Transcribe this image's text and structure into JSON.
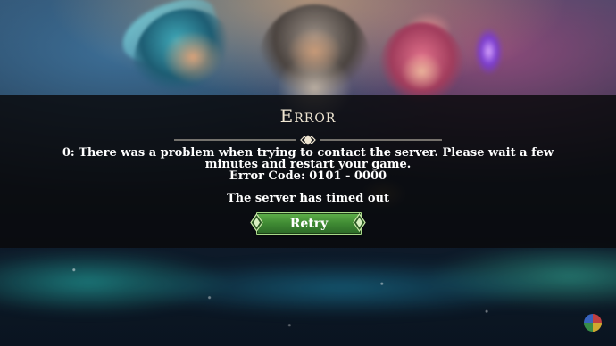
{
  "dialog": {
    "title": "Error",
    "message": "0: There was a problem when trying to contact the server. Please wait a few minutes and restart your game.",
    "error_code": "Error Code: 0101 - 0000",
    "status": "The server has timed out",
    "retry_label": "Retry"
  },
  "colors": {
    "overlay": "#0a0a0c",
    "title_text": "#efe6d2",
    "body_text": "#ffffff",
    "button_green": "#3f8a33",
    "button_border": "#a8d98a",
    "gem": "#c9e9a8"
  },
  "icons": {
    "divider": "diamond-divider-icon",
    "button_left_gem": "diamond-gem-icon",
    "button_right_gem": "diamond-gem-icon",
    "corner_badge": "app-badge-icon"
  }
}
